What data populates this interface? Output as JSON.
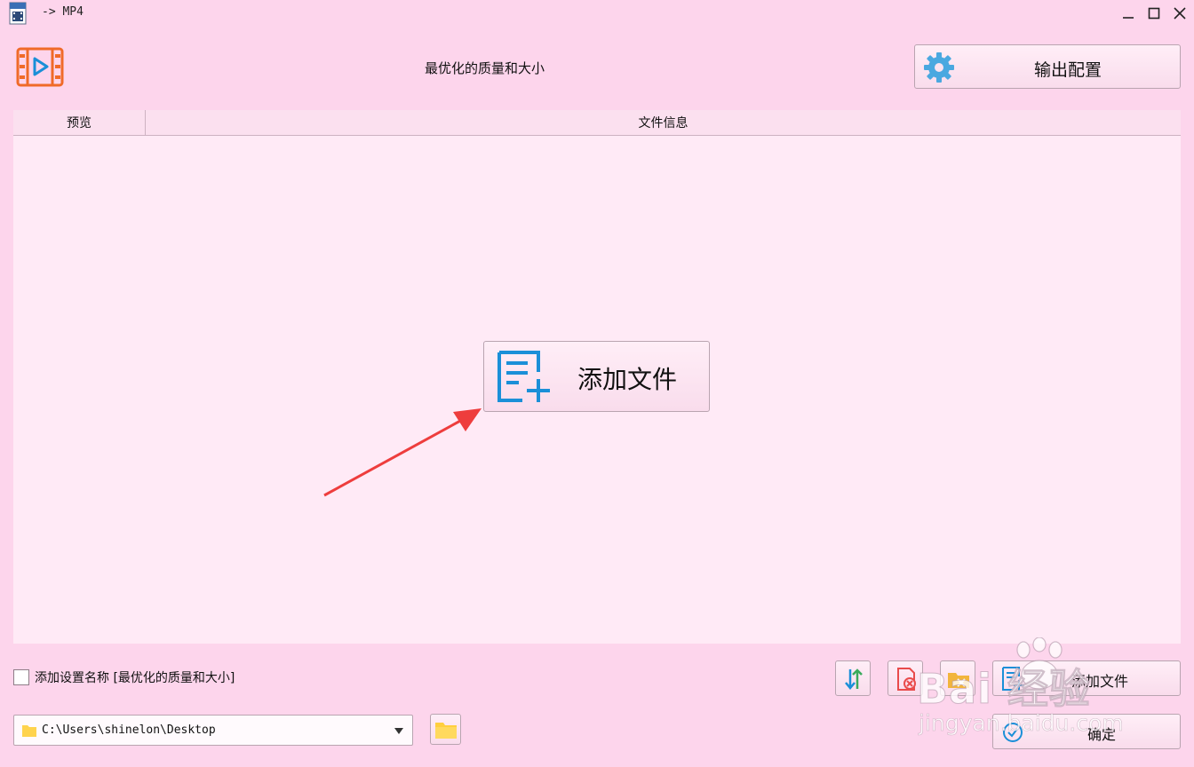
{
  "window": {
    "title": "-> MP4",
    "app_icon": "mp4-file-icon",
    "controls": {
      "minimize": "minimize-icon",
      "maximize": "maximize-icon",
      "close": "close-icon"
    }
  },
  "header": {
    "logo_icon": "video-film-icon",
    "preset_name": "最优化的质量和大小",
    "output_config_label": "输出配置",
    "output_config_icon": "gear-icon"
  },
  "file_list": {
    "columns": [
      "预览",
      "文件信息"
    ],
    "add_file_label": "添加文件",
    "add_file_icon": "add-document-icon"
  },
  "footer": {
    "add_setting_name_checked": false,
    "add_setting_name_label": "添加设置名称 [最优化的质量和大小]",
    "output_path": "C:\\Users\\shinelon\\Desktop",
    "sort_icon": "sort-icon",
    "remove_icon": "remove-file-icon",
    "clear_icon": "folder-clear-icon",
    "add_file_label": "添加文件",
    "ok_label": "确定",
    "browse_icon": "folder-icon"
  },
  "watermark": {
    "brand": "Bai 经验",
    "url": "jingyan.baidu.com"
  },
  "colors": {
    "background": "#fdd5ec",
    "list_background": "#ffeaf6",
    "accent_blue": "#1a8fd8",
    "logo_orange": "#f06a28",
    "arrow_red": "#ee3d3d"
  }
}
